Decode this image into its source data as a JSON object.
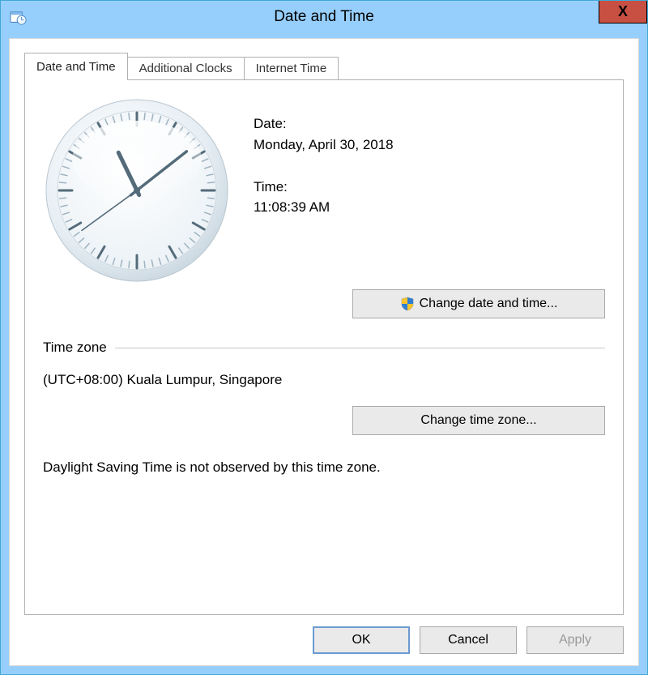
{
  "window": {
    "title": "Date and Time",
    "close_glyph": "X"
  },
  "tabs": [
    {
      "label": "Date and Time",
      "active": true
    },
    {
      "label": "Additional Clocks",
      "active": false
    },
    {
      "label": "Internet Time",
      "active": false
    }
  ],
  "datetime": {
    "date_label": "Date:",
    "date_value": "Monday, April 30, 2018",
    "time_label": "Time:",
    "time_value": "11:08:39 AM",
    "change_dt_label": "Change date and time...",
    "clock": {
      "hour": 11,
      "minute": 8,
      "second": 39
    }
  },
  "timezone": {
    "section_label": "Time zone",
    "value": "(UTC+08:00) Kuala Lumpur, Singapore",
    "change_tz_label": "Change time zone...",
    "dst_note": "Daylight Saving Time is not observed by this time zone."
  },
  "buttons": {
    "ok": "OK",
    "cancel": "Cancel",
    "apply": "Apply"
  },
  "colors": {
    "frame": "#97cffc",
    "close_bg": "#c85043",
    "btn_bg": "#eaeaea",
    "default_border": "#6b9bd2"
  }
}
